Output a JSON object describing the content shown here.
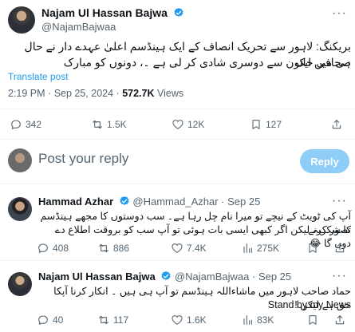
{
  "main_post": {
    "author_name": "Najam Ul Hassan Bajwa",
    "handle": "@NajamBajwaa",
    "text_line1": "بریکنگ: لاہور سے تحریک انصاف کے ایک ہینڈسم اعلیٰ عہدے دار نے حال ہی میں ایک",
    "text_line2": "صحافی خاتون سے دوسری شادی کر لی ہے ۔، دونوں کو مبارک",
    "translate_label": "Translate post",
    "time": "2:19 PM",
    "date": "Sep 25, 2024",
    "views_count": "572.7K",
    "views_label": "Views",
    "stats": {
      "replies": "342",
      "reposts": "1.5K",
      "likes": "12K",
      "bookmarks": "127"
    }
  },
  "composer": {
    "placeholder": "Post your reply",
    "reply_button": "Reply"
  },
  "replies": [
    {
      "author_name": "Hammad Azhar",
      "handle": "@Hammad_Azhar",
      "time": "Sep 25",
      "text_line1": "آپ کی ٹویٹ کے نیچے تو میرا نام چل رہا ہے۔ سب دوستوں کا مجھے ہینڈسم تصور کرنے",
      "text_line2": "کا شکریہ لیکن اگر کبھی ایسی بات ہوئی تو آپ سب کو بروقت اطلاع دے دوں گا 😂",
      "stats": {
        "replies": "408",
        "reposts": "886",
        "likes": "7.4K",
        "views": "275K"
      }
    },
    {
      "author_name": "Najam Ul Hassan Bajwa",
      "handle": "@NajamBajwaa",
      "time": "Sep 25",
      "text_line1": "حماد صاحب لاہور میں ماشاءاللہ ہینڈسم تو آپ ہی ہیں ۔ انکار کرنا آپکا حق ہے لیکن !",
      "text_line2": "Stand by my News",
      "stats": {
        "replies": "40",
        "reposts": "117",
        "likes": "1.6K",
        "views": "83K"
      }
    }
  ],
  "colors": {
    "accent": "#1d9bf0",
    "muted": "#536471",
    "reply_button_bg": "#8ecdf8"
  }
}
